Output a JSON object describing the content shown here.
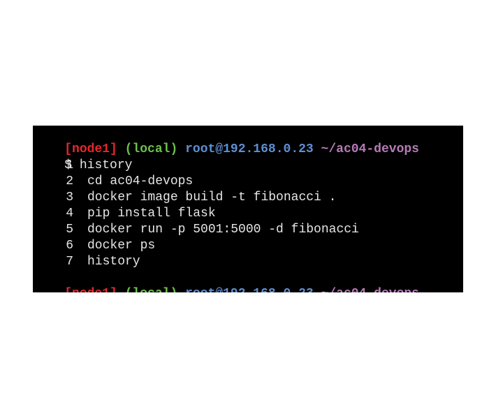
{
  "prompt": {
    "node": "[node1]",
    "local": "(local)",
    "userhost": "root@192.168.0.23",
    "path": "~/ac04-devops",
    "symbol": "$"
  },
  "typed_command": "history",
  "history": [
    {
      "num": "1",
      "cmd": ""
    },
    {
      "num": "2",
      "cmd": "cd ac04-devops"
    },
    {
      "num": "3",
      "cmd": "docker image build -t fibonacci ."
    },
    {
      "num": "4",
      "cmd": "pip install flask"
    },
    {
      "num": "5",
      "cmd": "docker run -p 5001:5000 -d fibonacci"
    },
    {
      "num": "6",
      "cmd": "docker ps"
    },
    {
      "num": "7",
      "cmd": "history"
    }
  ],
  "colors": {
    "background": "#000000",
    "text": "#e6e6e6",
    "node": "#e8262b",
    "local": "#6cc24a",
    "userhost": "#5f8fd4",
    "path": "#b77ab8"
  }
}
